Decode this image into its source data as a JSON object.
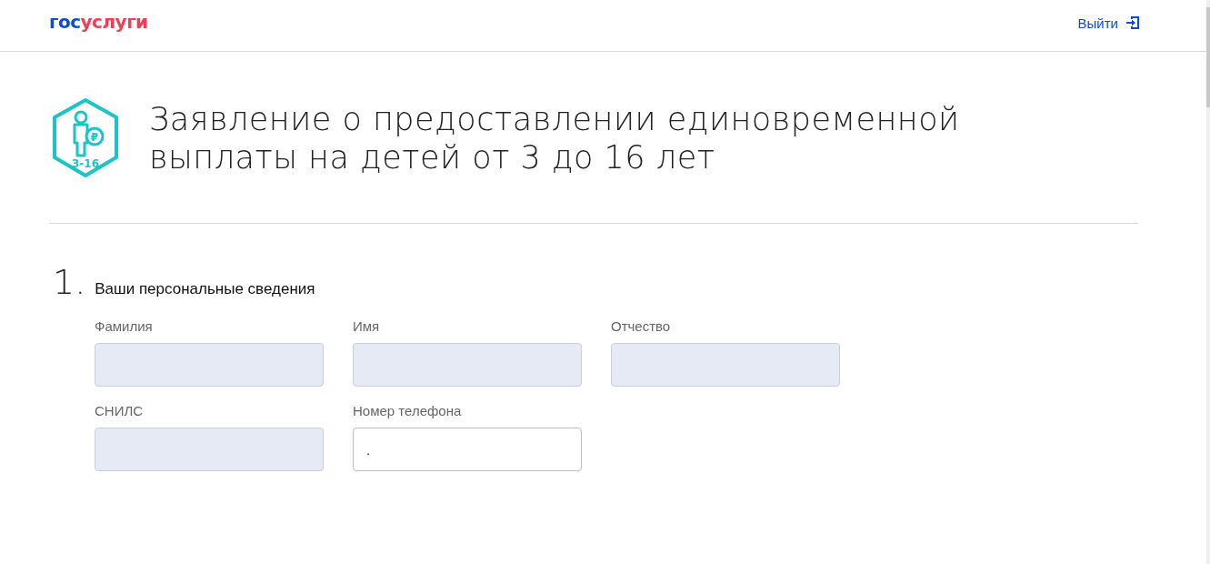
{
  "header": {
    "logo": [
      "гос",
      "услуги"
    ],
    "logout": "Выйти"
  },
  "page": {
    "icon_currency": "₽",
    "icon_badge": "3-16",
    "title": "Заявление о предоставлении единовременной выплаты на детей от 3 до 16 лет"
  },
  "sections": [
    {
      "number": "1.",
      "title": "Ваши персональные сведения",
      "fields": [
        {
          "label": "Фамилия",
          "disabled": true
        },
        {
          "label": "Имя",
          "disabled": true
        },
        {
          "label": "Отчество",
          "disabled": true
        },
        {
          "label": "СНИЛС",
          "disabled": true
        },
        {
          "label": "Номер телефона",
          "disabled": false,
          "value": "."
        }
      ]
    }
  ]
}
